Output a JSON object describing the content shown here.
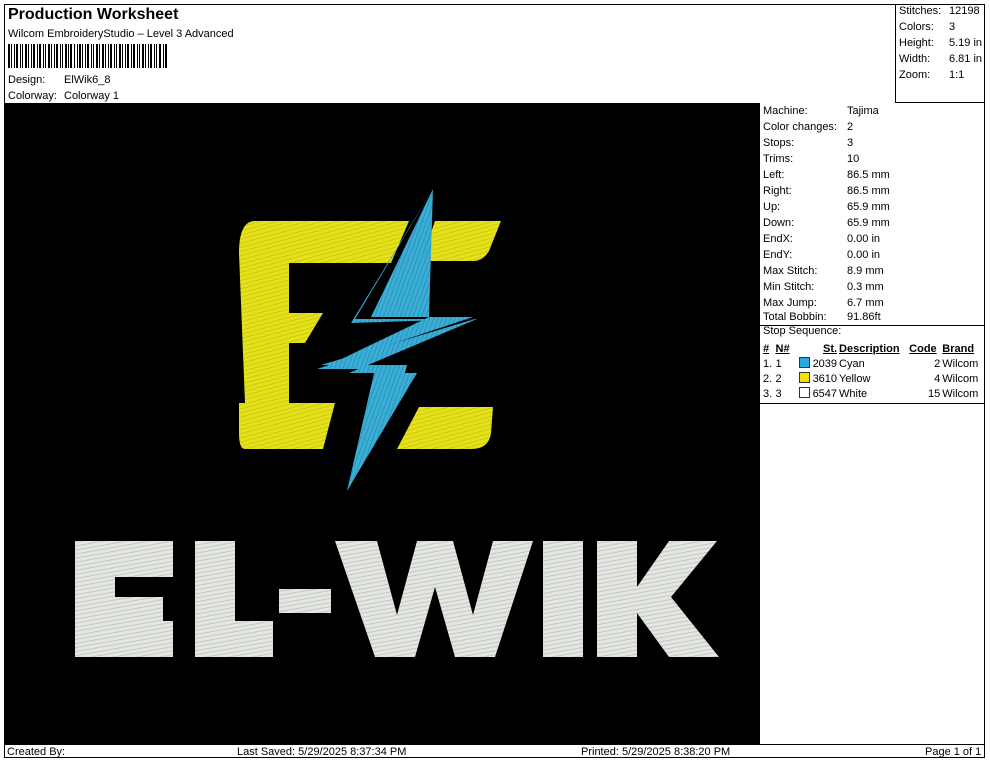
{
  "header": {
    "title": "Production Worksheet",
    "subtitle": "Wilcom EmbroideryStudio – Level 3 Advanced",
    "design_label": "Design:",
    "design_value": "ElWik6_8",
    "colorway_label": "Colorway:",
    "colorway_value": "Colorway 1"
  },
  "stats": [
    {
      "label": "Stitches:",
      "value": "12198"
    },
    {
      "label": "Colors:",
      "value": "3"
    },
    {
      "label": "Height:",
      "value": "5.19 in"
    },
    {
      "label": "Width:",
      "value": "6.81 in"
    },
    {
      "label": "Zoom:",
      "value": "1:1"
    }
  ],
  "design": {
    "text": "EL-WIK",
    "colors": {
      "background": "#000000",
      "yellow": "#e6e21a",
      "cyan": "#3aaed6",
      "white": "#e4e6e2"
    }
  },
  "machine_info": [
    {
      "label": "Machine:",
      "value": "Tajima"
    },
    {
      "label": "Color changes:",
      "value": "2"
    },
    {
      "label": "Stops:",
      "value": "3"
    },
    {
      "label": "Trims:",
      "value": "10"
    },
    {
      "label": "Left:",
      "value": "86.5 mm"
    },
    {
      "label": "Right:",
      "value": "86.5 mm"
    },
    {
      "label": "Up:",
      "value": "65.9 mm"
    },
    {
      "label": "Down:",
      "value": "65.9 mm"
    },
    {
      "label": "EndX:",
      "value": "0.00 in"
    },
    {
      "label": "EndY:",
      "value": "0.00 in"
    },
    {
      "label": "Max Stitch:",
      "value": "8.9 mm"
    },
    {
      "label": "Min Stitch:",
      "value": "0.3 mm"
    },
    {
      "label": "Max Jump:",
      "value": "6.7 mm"
    },
    {
      "label": "Total Bobbin:",
      "value": "91.86ft"
    }
  ],
  "stop_sequence": {
    "title": "Stop Sequence:",
    "headers": [
      "#",
      "N#",
      "St.",
      "Description",
      "Code",
      "Brand"
    ],
    "rows": [
      {
        "idx": "1.",
        "n": "1",
        "color": "#2aa9e0",
        "st": "2039",
        "desc": "Cyan",
        "code": "2",
        "brand": "Wilcom"
      },
      {
        "idx": "2.",
        "n": "2",
        "color": "#f2e400",
        "st": "3610",
        "desc": "Yellow",
        "code": "4",
        "brand": "Wilcom"
      },
      {
        "idx": "3.",
        "n": "3",
        "color": "#ffffff",
        "st": "6547",
        "desc": "White",
        "code": "15",
        "brand": "Wilcom"
      }
    ]
  },
  "footer": {
    "created": "Created By:",
    "saved": "Last Saved: 5/29/2025 8:37:34 PM",
    "printed": "Printed: 5/29/2025 8:38:20 PM",
    "page": "Page 1 of 1"
  }
}
